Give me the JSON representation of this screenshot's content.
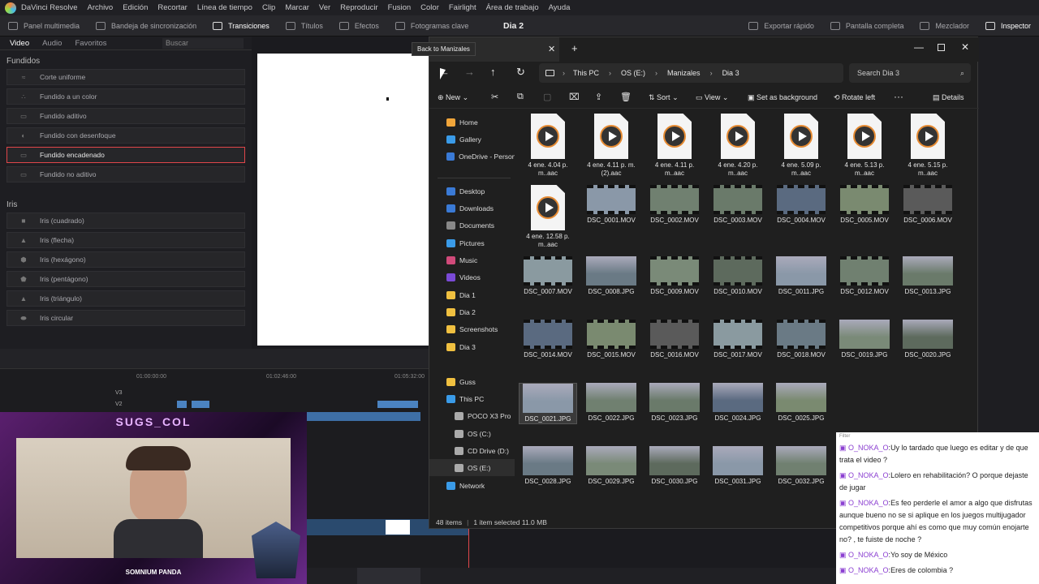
{
  "app": {
    "name": "DaVinci Resolve",
    "menu": [
      "Archivo",
      "Edición",
      "Recortar",
      "Línea de tiempo",
      "Clip",
      "Marcar",
      "Ver",
      "Reproducir",
      "Fusion",
      "Color",
      "Fairlight",
      "Área de trabajo",
      "Ayuda"
    ]
  },
  "toolbar": {
    "left": [
      "Panel multimedia",
      "Bandeja de sincronización",
      "Transiciones",
      "Títulos",
      "Efectos",
      "Fotogramas clave"
    ],
    "project": "Dia 2",
    "right": [
      "Exportar rápido",
      "Pantalla completa",
      "Mezclador",
      "Inspector"
    ]
  },
  "effects": {
    "tabs": [
      "Video",
      "Audio",
      "Favoritos"
    ],
    "search": "Buscar",
    "sec1": "Fundidos",
    "sec1items": [
      "Corte uniforme",
      "Fundido a un color",
      "Fundido aditivo",
      "Fundido con desenfoque",
      "Fundido encadenado",
      "Fundido no aditivo"
    ],
    "sec2": "Iris",
    "sec2items": [
      "Iris (cuadrado)",
      "Iris (flecha)",
      "Iris (hexágono)",
      "Iris (pentágono)",
      "Iris (triángulo)",
      "Iris circular"
    ]
  },
  "timeline": {
    "tc": [
      "01:00:00:00",
      "01:02:46:00",
      "01:05:32:00"
    ],
    "tracks": [
      "V3",
      "V2"
    ]
  },
  "tooltip": "Back to Manizales",
  "explorer": {
    "crumbs": [
      "This PC",
      "OS (E:)",
      "Manizales",
      "Dia 3"
    ],
    "search": "Search Dia 3",
    "cmd": [
      "New",
      "Sort",
      "View",
      "Set as background",
      "Rotate left",
      "Details"
    ],
    "nav": [
      "Home",
      "Gallery",
      "OneDrive - Persona",
      "Desktop",
      "Downloads",
      "Documents",
      "Pictures",
      "Music",
      "Videos",
      "Dia 1",
      "Dia 2",
      "Screenshots",
      "Dia 3",
      "Guss",
      "This PC",
      "POCO X3 Pro",
      "OS (C:)",
      "CD Drive (D:)",
      "OS (E:)",
      "Network"
    ],
    "files": [
      "4 ene. 4.04 p. m..aac",
      "4 ene. 4.11 p. m.(2).aac",
      "4 ene. 4.11 p. m..aac",
      "4 ene. 4.20 p. m..aac",
      "4 ene. 5.09 p. m..aac",
      "4 ene. 5.13 p. m..aac",
      "4 ene. 5.15 p. m..aac",
      "4 ene. 12.58 p. m..aac",
      "DSC_0001.MOV",
      "DSC_0002.MOV",
      "DSC_0003.MOV",
      "DSC_0004.MOV",
      "DSC_0005.MOV",
      "DSC_0006.MOV",
      "DSC_0007.MOV",
      "DSC_0008.JPG",
      "DSC_0009.MOV",
      "DSC_0010.MOV",
      "DSC_0011.JPG",
      "DSC_0012.MOV",
      "DSC_0013.JPG",
      "DSC_0014.MOV",
      "DSC_0015.MOV",
      "DSC_0016.MOV",
      "DSC_0017.MOV",
      "DSC_0018.MOV",
      "DSC_0019.JPG",
      "DSC_0020.JPG",
      "DSC_0021.JPG",
      "DSC_0022.JPG",
      "DSC_0023.JPG",
      "DSC_0024.JPG",
      "DSC_0025.JPG",
      "",
      "",
      "DSC_0028.JPG",
      "DSC_0029.JPG",
      "DSC_0030.JPG",
      "DSC_0031.JPG",
      "DSC_0032.JPG"
    ],
    "status": [
      "48 items",
      "1 item selected  11.0 MB"
    ]
  },
  "stream": {
    "top": "SUGS_COL",
    "bottom": "SOMNIUM PANDA"
  },
  "chat": {
    "header": "Filter",
    "lines": [
      {
        "user": "O_NOKA_O",
        "msg": "Uy lo tardado que luego es editar y de que trata el video ?"
      },
      {
        "user": "O_NOKA_O",
        "msg": "Lolero en rehabilitación? O porque dejaste de jugar"
      },
      {
        "user": "O_NOKA_O",
        "msg": "Es feo perderle el amor a algo que disfrutas aunque bueno no se si aplique en los juegos multijugador competitivos porque ahí es como que muy común enojarte no? , te fuiste de noche ?"
      },
      {
        "user": "O_NOKA_O",
        "msg": "Yo soy de México"
      },
      {
        "user": "O_NOKA_O",
        "msg": "Eres de colombia ?"
      }
    ]
  },
  "colors": {
    "accent": "#e0464a",
    "selection": "#3a3a3a"
  }
}
